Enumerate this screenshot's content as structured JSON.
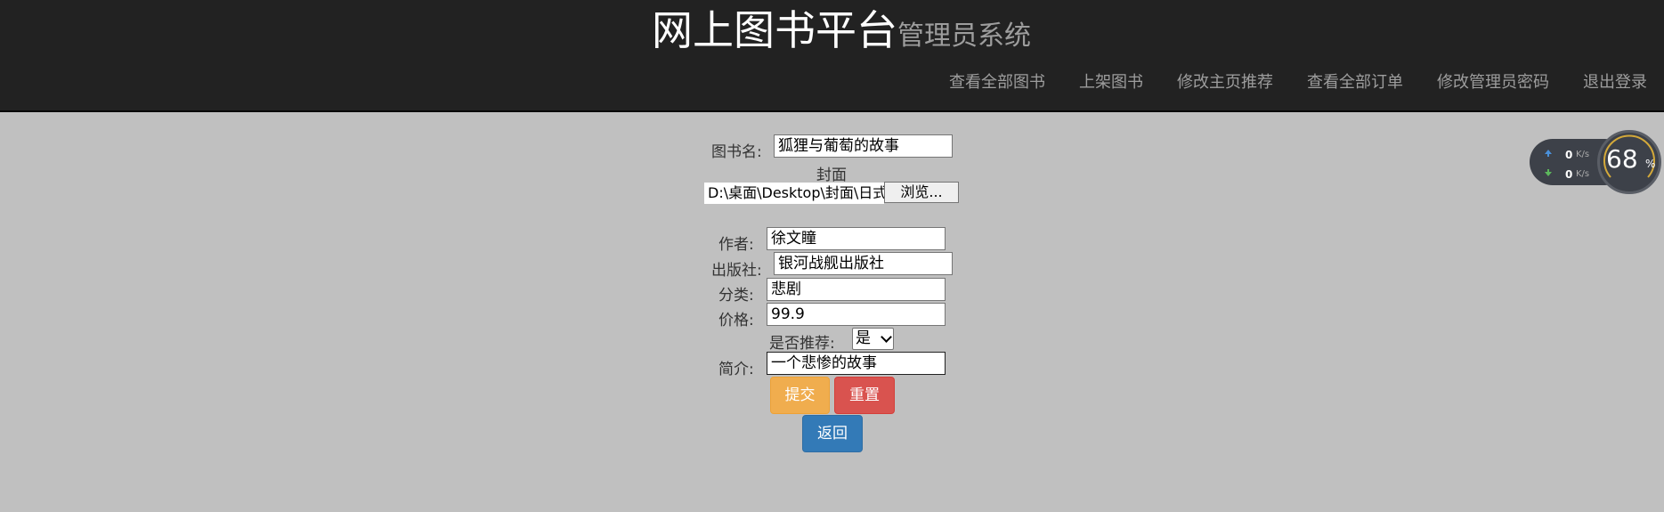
{
  "brand": {
    "main": "网上图书平台",
    "sub": "管理员系统"
  },
  "nav": [
    "查看全部图书",
    "上架图书",
    "修改主页推荐",
    "查看全部订单",
    "修改管理员密码",
    "退出登录"
  ],
  "form": {
    "title_label": "图书名:",
    "title_value": "狐狸与葡萄的故事",
    "cover_label": "封面",
    "cover_path": "D:\\桌面\\Desktop\\封面\\日式",
    "browse_label": "浏览...",
    "author_label": "作者:",
    "author_value": "徐文瞳",
    "publisher_label": "出版社:",
    "publisher_value": "银河战舰出版社",
    "category_label": "分类:",
    "category_value": "悲剧",
    "price_label": "价格:",
    "price_value": "99.9",
    "recommend_label": "是否推荐:",
    "recommend_value": "是",
    "intro_label": "简介:",
    "intro_value": "一个悲惨的故事",
    "submit_label": "提交",
    "reset_label": "重置",
    "back_label": "返回"
  },
  "net_widget": {
    "upload_value": "0",
    "upload_unit": "K/s",
    "download_value": "0",
    "download_unit": "K/s",
    "percent": "68",
    "percent_sign": "%",
    "upload_color": "#4a90d9",
    "download_color": "#5cb85c"
  }
}
